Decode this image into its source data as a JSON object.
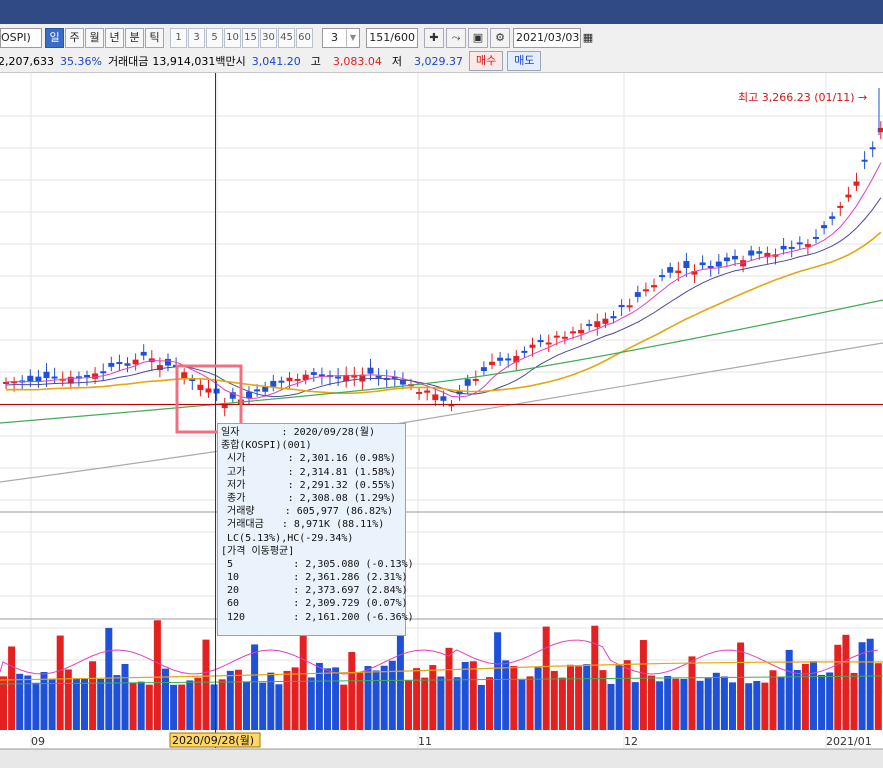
{
  "toolbar": {
    "code_fragment": "OSPI)",
    "periods": [
      "일",
      "주",
      "월",
      "년",
      "분",
      "틱"
    ],
    "active_period": "일",
    "intervals": [
      "1",
      "3",
      "5",
      "10",
      "15",
      "30",
      "45",
      "60"
    ],
    "custom_interval": "3",
    "count": "151/600",
    "date": "2021/03/03"
  },
  "quote": {
    "volume_fragment": "2,207,633",
    "volume_ratio": "35.36%",
    "amount_label": "거래대금",
    "amount": "13,914,031백만",
    "open_label": "시",
    "open": "3,041.20",
    "high_label": "고",
    "high": "3,083.04",
    "low_label": "저",
    "low": "3,029.37",
    "buy": "매수",
    "sell": "매도"
  },
  "chart": {
    "peak_label": "최고 3,266.23 (01/11) →",
    "x_labels": [
      "09",
      "2020/09/28(월)",
      "11",
      "12",
      "2021/01"
    ],
    "colors": {
      "up": "#e52020",
      "down": "#1e50d8",
      "ma5": "#e040c0",
      "ma10": "#4a4a9a",
      "ma20": "#e4a70e",
      "ma60": "#44aa55",
      "ma120": "#aaaaaa",
      "cursor": "#b00000",
      "highlight": "#f07080"
    }
  },
  "tooltip": {
    "lines": [
      "일자       : 2020/09/28(월)",
      "종합(KOSPI)(001)",
      " 시가       : 2,301.16 (0.98%)",
      " 고가       : 2,314.81 (1.58%)",
      " 저가       : 2,291.32 (0.55%)",
      " 종가       : 2,308.08 (1.29%)",
      " 거래량     : 605,977 (86.82%)",
      " 거래대금   : 8,971K (88.11%)",
      " LC(5.13%),HC(-29.34%)",
      "[가격 이동평균]",
      " 5          : 2,305.080 (-0.13%)",
      " 10         : 2,361.286 (2.31%)",
      " 20         : 2,373.697 (2.84%)",
      " 60         : 2,309.729 (0.07%)",
      " 120        : 2,161.200 (-6.36%)"
    ]
  }
}
